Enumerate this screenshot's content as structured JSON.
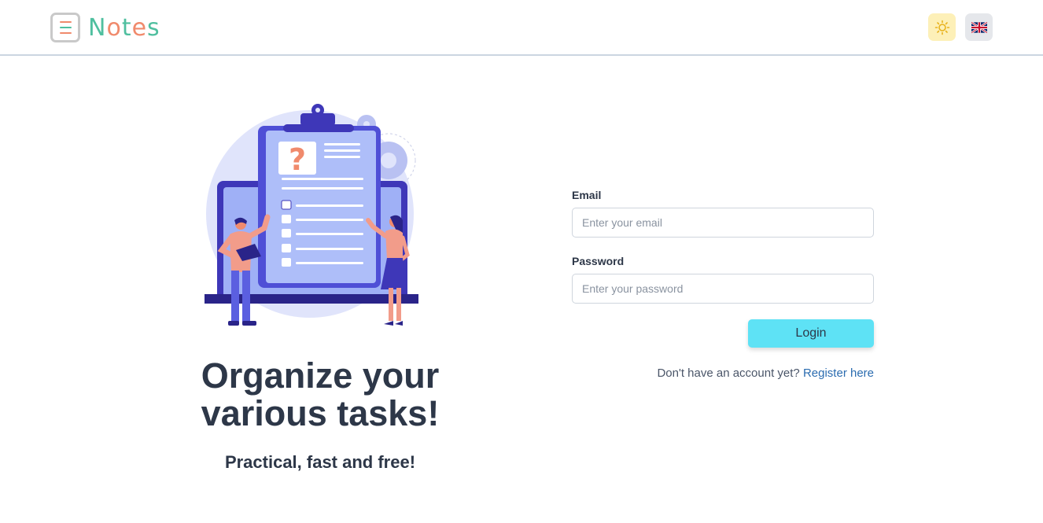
{
  "header": {
    "logo_text_parts": [
      "N",
      "o",
      "t",
      "e",
      "s"
    ],
    "theme_toggle_icon": "sun-icon",
    "language_icon": "uk-flag-icon"
  },
  "hero": {
    "headline_line1": "Organize your",
    "headline_line2": "various tasks!",
    "subheadline": "Practical, fast and free!",
    "illustration_icon": "clipboard-checklist-illustration"
  },
  "form": {
    "email_label": "Email",
    "email_placeholder": "Enter your email",
    "email_value": "",
    "password_label": "Password",
    "password_placeholder": "Enter your password",
    "password_value": "",
    "login_label": "Login",
    "register_prompt": "Don't have an account yet?",
    "register_link": "Register here"
  },
  "colors": {
    "accent": "#5ee2f5",
    "logo_green": "#4fbf9f",
    "logo_orange": "#f08a6c",
    "link": "#2b6cb0",
    "text": "#2d3748"
  }
}
